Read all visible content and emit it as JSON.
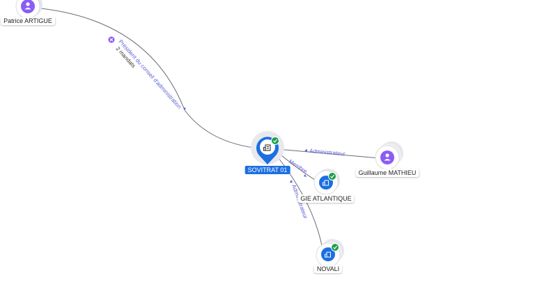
{
  "colors": {
    "company": "#1b6fe0",
    "person": "#8b5cf6",
    "edge_label": "#5b5fd6",
    "check": "#1e9e4a",
    "closed": "#8b5cf6"
  },
  "nodes": {
    "patrice": {
      "label": "Patrice ARTIGUE",
      "kind": "person",
      "icon": "person-icon"
    },
    "sovitrat": {
      "label": "SOVITRAT 01",
      "kind": "company-selected",
      "icon": "building-icon",
      "verified": true
    },
    "guillaume": {
      "label": "Guillaume MATHIEU",
      "kind": "person",
      "icon": "person-icon"
    },
    "gie": {
      "label": "GIE ATLANTIQUE",
      "kind": "company",
      "icon": "building-icon",
      "verified": true
    },
    "novali": {
      "label": "NOVALI",
      "kind": "company",
      "icon": "building-icon",
      "verified": true
    }
  },
  "edges": {
    "patrice_sovitrat": {
      "label": "Président du conseil d'administration",
      "sublabel": "2 mandats",
      "status": "closed"
    },
    "guillaume_sovitrat": {
      "label": "Administrateur"
    },
    "sovitrat_gie": {
      "label": "Membre"
    },
    "novali_sovitrat": {
      "label": "Administrateur"
    }
  }
}
